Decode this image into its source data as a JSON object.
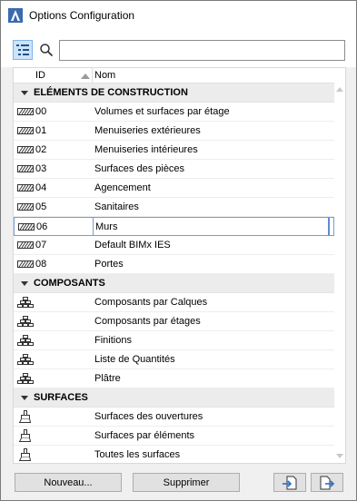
{
  "window": {
    "title": "Options Configuration"
  },
  "toolbar": {
    "search_placeholder": "",
    "search_value": ""
  },
  "columns": {
    "id": "ID",
    "nom": "Nom"
  },
  "groups": [
    {
      "label": "ELÉMENTS DE CONSTRUCTION",
      "icon": "hatch-icon",
      "items": [
        {
          "id": "00",
          "name": "Volumes et surfaces par étage"
        },
        {
          "id": "01",
          "name": "Menuiseries extérieures"
        },
        {
          "id": "02",
          "name": "Menuiseries intérieures"
        },
        {
          "id": "03",
          "name": "Surfaces des pièces"
        },
        {
          "id": "04",
          "name": "Agencement"
        },
        {
          "id": "05",
          "name": "Sanitaires"
        },
        {
          "id": "06",
          "name": "Murs",
          "selected": true
        },
        {
          "id": "07",
          "name": "Default BIMx IES"
        },
        {
          "id": "08",
          "name": "Portes"
        }
      ]
    },
    {
      "label": "COMPOSANTS",
      "icon": "component-stack-icon",
      "items": [
        {
          "id": "",
          "name": "Composants par Calques"
        },
        {
          "id": "",
          "name": "Composants par étages"
        },
        {
          "id": "",
          "name": "Finitions"
        },
        {
          "id": "",
          "name": "Liste de Quantités"
        },
        {
          "id": "",
          "name": "Plâtre"
        }
      ]
    },
    {
      "label": "SURFACES",
      "icon": "paint-brush-icon",
      "items": [
        {
          "id": "",
          "name": "Surfaces des ouvertures"
        },
        {
          "id": "",
          "name": "Surfaces par éléments"
        },
        {
          "id": "",
          "name": "Toutes les surfaces"
        }
      ]
    }
  ],
  "footer": {
    "new_label": "Nouveau...",
    "delete_label": "Supprimer"
  },
  "colors": {
    "selection_border": "#5b8dd2",
    "group_bg": "#ececec",
    "toolbar_active": "#cde4f7"
  }
}
